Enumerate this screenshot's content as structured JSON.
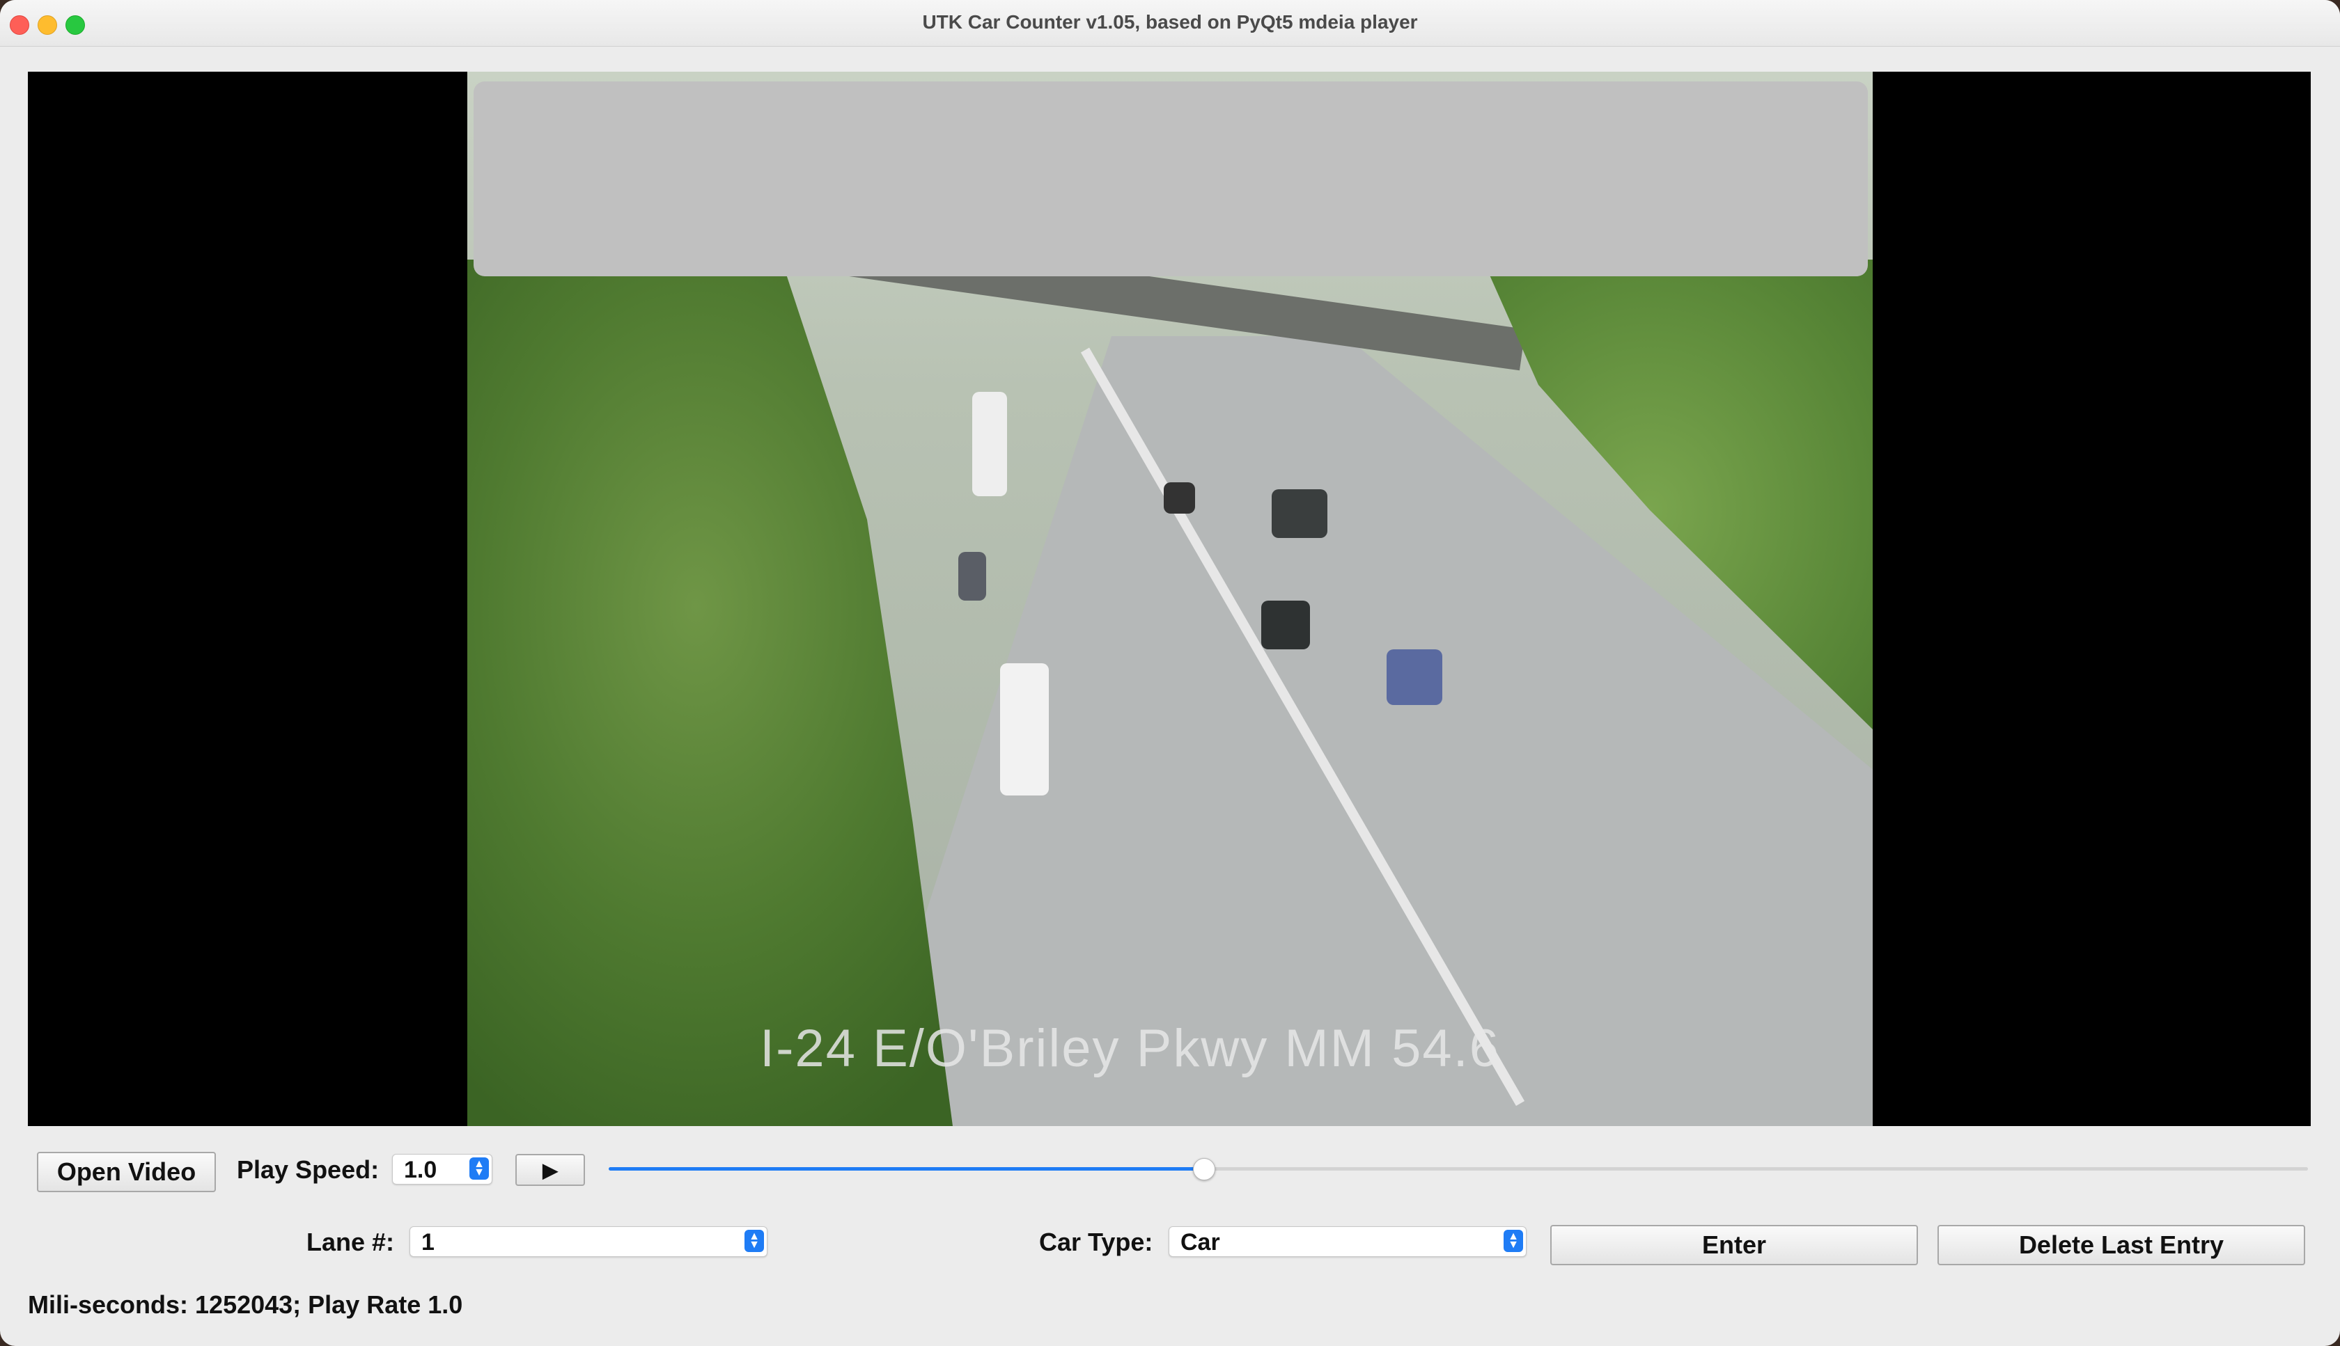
{
  "window": {
    "title": "UTK Car Counter v1.05, based on PyQt5 mdeia player"
  },
  "video": {
    "caption": "I-24 E/O'Briley Pkwy MM 54.6"
  },
  "controls": {
    "open_video_label": "Open Video",
    "play_speed_label": "Play Speed:",
    "play_speed_value": "1.0",
    "play_icon": "play-icon",
    "position_fraction": 0.35,
    "lane_label": "Lane #:",
    "lane_value": "1",
    "car_type_label": "Car Type:",
    "car_type_value": "Car",
    "enter_label": "Enter",
    "delete_label": "Delete Last Entry"
  },
  "status": {
    "text": "Mili-seconds: 1252043; Play Rate 1.0"
  },
  "colors": {
    "accent": "#1f7cf5",
    "close": "#fe5f57",
    "minimize": "#febc2e",
    "maximize": "#28c840"
  }
}
